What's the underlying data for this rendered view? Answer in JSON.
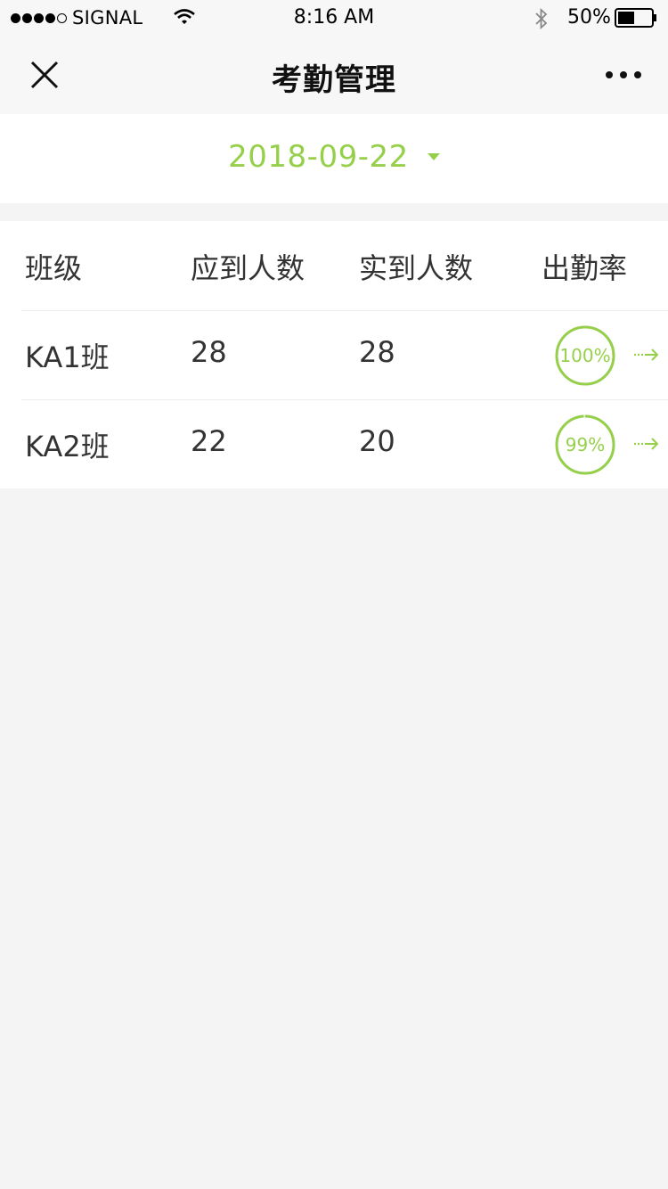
{
  "status_bar": {
    "carrier": "SIGNAL",
    "time": "8:16 AM",
    "battery_percent": "50%",
    "signal_bars_filled": 4,
    "signal_bars_total": 5,
    "battery_level": 0.5
  },
  "nav": {
    "title": "考勤管理",
    "close_icon": "close-icon",
    "more_icon": "more-icon"
  },
  "date_selector": {
    "date": "2018-09-22",
    "icon": "caret-down-icon"
  },
  "table": {
    "headers": [
      "班级",
      "应到人数",
      "实到人数",
      "出勤率"
    ],
    "rows": [
      {
        "class_name": "KA1班",
        "expected": "28",
        "actual": "28",
        "rate_label": "100%",
        "rate_value": 1.0
      },
      {
        "class_name": "KA2班",
        "expected": "22",
        "actual": "20",
        "rate_label": "99%",
        "rate_value": 0.99
      }
    ],
    "row_action_icon": "arrow-right-icon"
  },
  "colors": {
    "accent": "#96d04a",
    "background": "#f4f4f4",
    "bar_background": "#f7f7f7",
    "text": "#333333"
  }
}
